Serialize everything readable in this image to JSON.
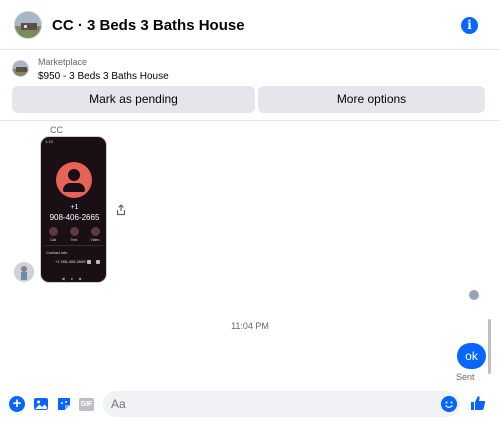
{
  "header": {
    "title": "CC · 3 Beds 3 Baths House",
    "info_icon": "i"
  },
  "marketplace": {
    "label": "Marketplace",
    "listing": "$950 - 3 Beds 3 Baths House",
    "pending_button": "Mark as pending",
    "more_button": "More options"
  },
  "conversation": {
    "sender_name": "CC",
    "shared_screenshot": {
      "status_bar": "1:13",
      "contact_name": "+1",
      "phone_number": "908-406-2665",
      "actions": [
        "Call",
        "Text",
        "Video"
      ],
      "contact_info_label": "Contact info",
      "contact_info_number": "+1 908-406-2665"
    },
    "timestamp": "11:04 PM",
    "my_message": "ok",
    "message_status": "Sent"
  },
  "composer": {
    "placeholder": "Aa",
    "gif_label": "GIF",
    "plus_icon": "+"
  },
  "colors": {
    "accent": "#0866ff",
    "button_bg": "#e4e6eb"
  }
}
